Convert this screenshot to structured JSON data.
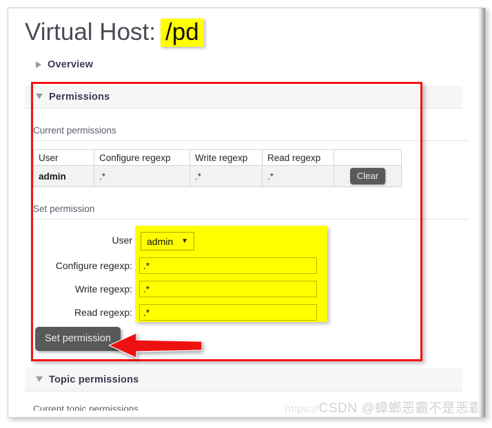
{
  "page": {
    "title_prefix": "Virtual Host:",
    "vhost_name": "/pd"
  },
  "overview": {
    "label": "Overview",
    "icon": "triangle-right-icon",
    "expanded": false
  },
  "permissions_section": {
    "label": "Permissions",
    "icon": "triangle-down-icon",
    "expanded": true,
    "current_permissions_label": "Current permissions",
    "table": {
      "columns": [
        "User",
        "Configure regexp",
        "Write regexp",
        "Read regexp",
        ""
      ],
      "rows": [
        {
          "user": "admin",
          "configure_regexp": ".*",
          "write_regexp": ".*",
          "read_regexp": ".*",
          "action_label": "Clear"
        }
      ]
    },
    "set_permission_label": "Set permission",
    "form": {
      "user_label": "User",
      "user_value": "admin",
      "user_caret_icon": "chevron-down-icon",
      "configure_label": "Configure regexp:",
      "configure_value": ".*",
      "write_label": "Write regexp:",
      "write_value": ".*",
      "read_label": "Read regexp:",
      "read_value": ".*",
      "submit_label": "Set permission"
    }
  },
  "topic_permissions_section": {
    "label": "Topic permissions",
    "icon": "triangle-down-icon",
    "expanded": true,
    "current_topic_permissions_label": "Current topic permissions"
  },
  "annotations": {
    "highlight_color": "#ffff00",
    "box_color": "#f51111",
    "arrow_color": "#ee1111",
    "arrow_direction": "left"
  },
  "watermark": {
    "url": "https://",
    "text": "CSDN @蟑螂恶霸不是恶霸"
  }
}
